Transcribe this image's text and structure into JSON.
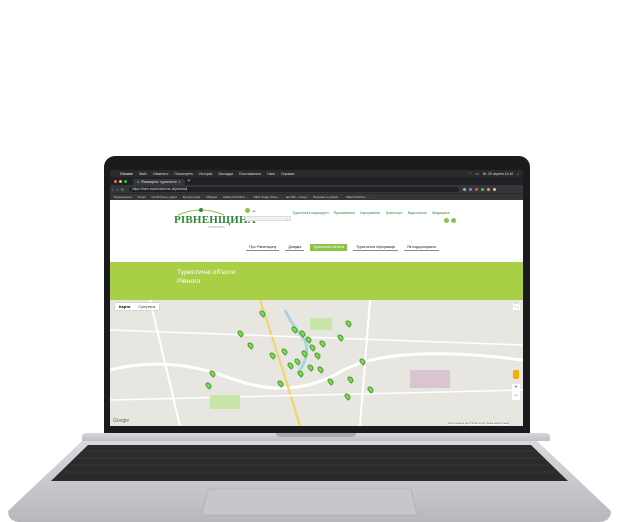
{
  "mac_menubar": {
    "app": "Chrome",
    "items": [
      "Файл",
      "Изменить",
      "Посмотреть",
      "История",
      "Закладки",
      "Пользователи",
      "Окно",
      "Справка"
    ],
    "status": "Вт, 25 червня 14:40"
  },
  "browser": {
    "tab_title": "Рівнещина: туристичні",
    "url": "https://rivne.travel/uk/rivne-objects#all",
    "bookmarks": [
      "Приложения",
      "Gmail",
      "CovidTravel_Agent",
      "Бухгалтерия",
      "inDigest",
      "Adobe Portfolio |...",
      "SEO Image Sizes...",
      "англійс - пошук",
      "Переваги в дизай...",
      "Watch Archive -..."
    ]
  },
  "site": {
    "logo": "РІВНЕНЩИНА",
    "logo_sub": "ТУРИСТИЧНА",
    "lang": "ua",
    "top_nav": [
      "Туристичні маршрути",
      "Проживання",
      "Харчування",
      "Транспорт",
      "Відпочинок",
      "Медицина"
    ],
    "main_nav": [
      {
        "label": "Про Рівненщину",
        "active": false
      },
      {
        "label": "Довідка",
        "active": false
      },
      {
        "label": "Туристичні об'єкти",
        "active": true
      },
      {
        "label": "Туристична інформація",
        "active": false
      },
      {
        "label": "Як подорожувати",
        "active": false
      }
    ],
    "hero_title_line1": "Туристичні об'єкти",
    "hero_title_line2": "Рівного",
    "accent_color": "#a8cf45"
  },
  "map": {
    "type_options": [
      {
        "label": "Карта",
        "selected": true
      },
      {
        "label": "Супутник",
        "selected": false
      }
    ],
    "google_label": "Google",
    "copyright": "Картографічні дані ©2019 Google   Умови використання",
    "zoom_in": "+",
    "zoom_out": "−",
    "fullscreen_icon": "fullscreen-icon"
  }
}
